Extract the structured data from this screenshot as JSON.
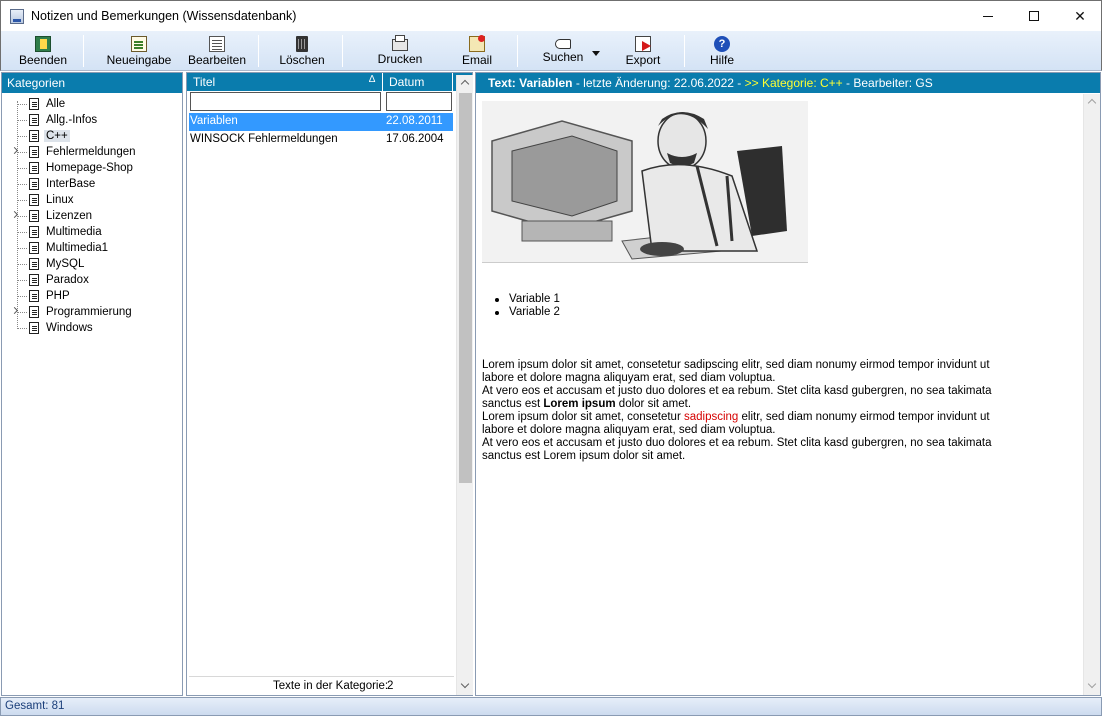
{
  "window": {
    "title": "Notizen und Bemerkungen (Wissensdatenbank)"
  },
  "toolbar": {
    "buttons": [
      {
        "label": "Beenden",
        "icon": "exit-door-icon"
      },
      {
        "label": "Neueingabe",
        "icon": "new-note-icon"
      },
      {
        "label": "Bearbeiten",
        "icon": "edit-note-icon"
      },
      {
        "label": "Löschen",
        "icon": "trash-icon"
      },
      {
        "label": "Drucken",
        "icon": "printer-icon"
      },
      {
        "label": "Email",
        "icon": "email-icon"
      },
      {
        "label": "Suchen",
        "icon": "search-hand-icon"
      },
      {
        "label": "Export",
        "icon": "export-icon"
      },
      {
        "label": "Hilfe",
        "icon": "help-icon"
      }
    ]
  },
  "categories": {
    "header": "Kategorien",
    "items": [
      {
        "label": "Alle",
        "expandable": false
      },
      {
        "label": "Allg.-Infos",
        "expandable": false
      },
      {
        "label": "C++",
        "expandable": false,
        "selected": true
      },
      {
        "label": "Fehlermeldungen",
        "expandable": true
      },
      {
        "label": "Homepage-Shop",
        "expandable": false
      },
      {
        "label": "InterBase",
        "expandable": false
      },
      {
        "label": "Linux",
        "expandable": false
      },
      {
        "label": "Lizenzen",
        "expandable": true
      },
      {
        "label": "Multimedia",
        "expandable": false
      },
      {
        "label": "Multimedia1",
        "expandable": false
      },
      {
        "label": "MySQL",
        "expandable": false
      },
      {
        "label": "Paradox",
        "expandable": false
      },
      {
        "label": "PHP",
        "expandable": false
      },
      {
        "label": "Programmierung",
        "expandable": true
      },
      {
        "label": "Windows",
        "expandable": false
      }
    ]
  },
  "list": {
    "columns": {
      "titel": "Titel",
      "datum": "Datum"
    },
    "sort_indicator": "∆",
    "filter": {
      "titel": "",
      "datum": ""
    },
    "rows": [
      {
        "titel": "Variablen",
        "datum": "22.08.2011",
        "selected": true
      },
      {
        "titel": "WINSOCK Fehlermeldungen",
        "datum": "17.06.2004",
        "selected": false
      }
    ],
    "footer_label": "Texte in der Kategorie:",
    "footer_count": "2"
  },
  "text": {
    "header_title": "Text: Variablen",
    "header_date": "- letzte Änderung: 22.06.2022 -",
    "header_category": ">> Kategorie: C++",
    "header_editor": "- Bearbeiter: GS",
    "bullets": [
      "Variable 1",
      "Variable 2"
    ],
    "p1": "Lorem ipsum dolor sit amet, consetetur sadipscing elitr, sed diam nonumy eirmod tempor invidunt ut labore et dolore magna aliquyam erat, sed diam voluptua.",
    "p2a": "At vero eos et accusam et justo duo dolores et ea rebum. Stet clita kasd gubergren, no sea takimata sanctus est",
    "p2b": "Lorem ipsum",
    "p2c": "dolor sit amet.",
    "p3a": "Lorem ipsum dolor sit amet, consetetur",
    "p3b": "sadipscing",
    "p3c": "elitr, sed diam nonumy eirmod tempor invidunt ut labore et dolore magna aliquyam erat, sed diam voluptua.",
    "p4": "At vero eos et accusam et justo duo dolores et ea rebum. Stet clita kasd gubergren, no sea takimata sanctus est Lorem ipsum dolor sit amet."
  },
  "status": {
    "text": "Gesamt: 81"
  },
  "colors": {
    "header_bg": "#0a7cad",
    "selection": "#3399ff",
    "category_highlight": "#ffff33",
    "emphasis_red": "#d60000"
  }
}
